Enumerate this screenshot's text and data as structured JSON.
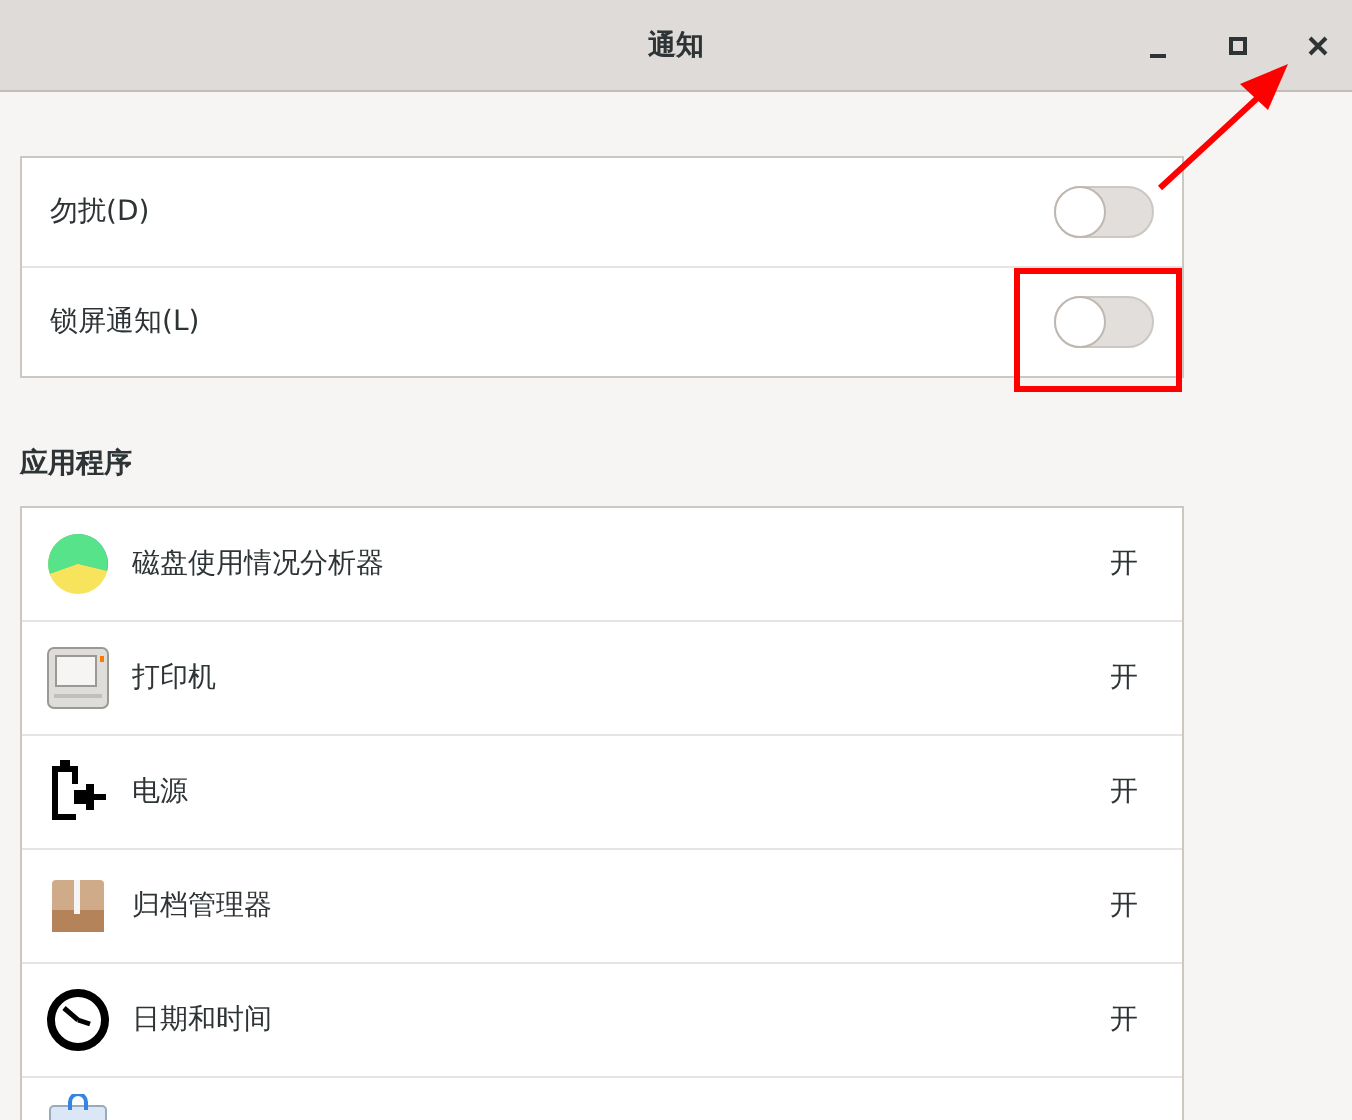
{
  "window": {
    "title": "通知",
    "controls": [
      {
        "kind": "minimize"
      },
      {
        "kind": "maximize"
      },
      {
        "kind": "close"
      }
    ]
  },
  "settings": [
    {
      "label": "勿扰(D)",
      "on": false
    },
    {
      "label": "锁屏通知(L)",
      "on": false
    }
  ],
  "apps_heading": "应用程序",
  "apps": [
    {
      "name": "磁盘使用情况分析器",
      "status": "开"
    },
    {
      "name": "打印机",
      "status": "开"
    },
    {
      "name": "电源",
      "status": "开"
    },
    {
      "name": "归档管理器",
      "status": "开"
    },
    {
      "name": "日期和时间",
      "status": "开"
    },
    {
      "kind": "partial"
    }
  ],
  "annotation_box": true,
  "annotation_arrow": true
}
